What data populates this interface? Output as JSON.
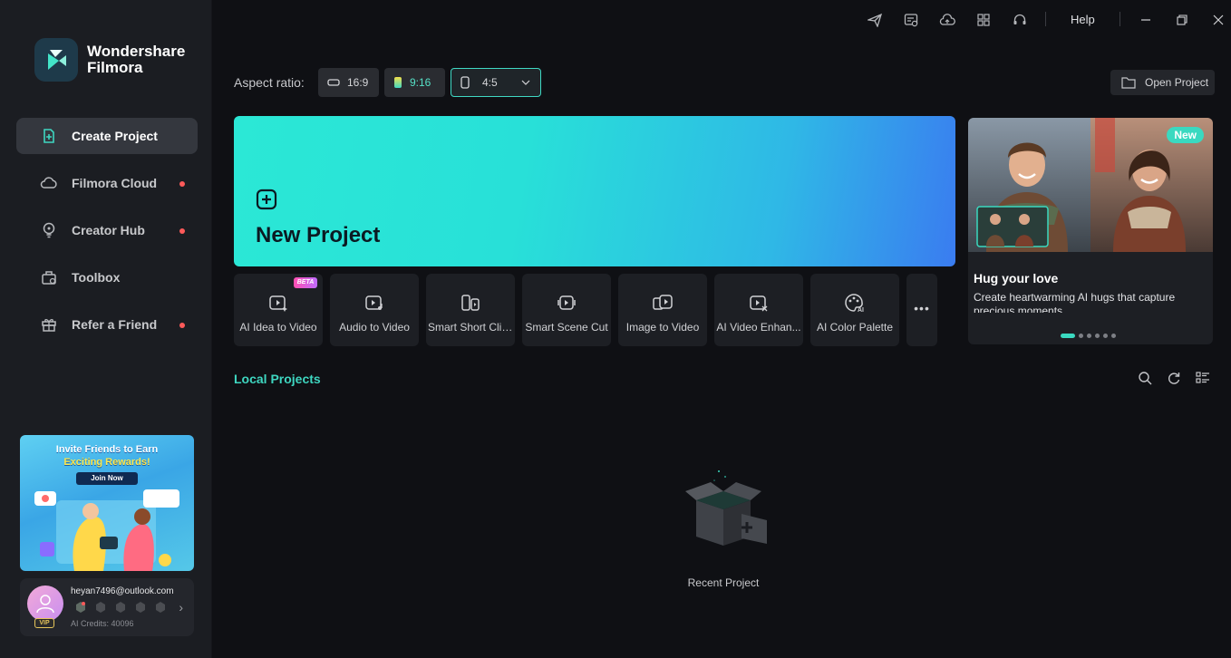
{
  "app": {
    "brand_line1": "Wondershare",
    "brand_line2": "Filmora"
  },
  "sidebar": {
    "items": [
      {
        "label": "Create Project",
        "icon": "create-project-icon",
        "active": true,
        "dot": false
      },
      {
        "label": "Filmora Cloud",
        "icon": "cloud-icon",
        "active": false,
        "dot": true
      },
      {
        "label": "Creator Hub",
        "icon": "lightbulb-icon",
        "active": false,
        "dot": true
      },
      {
        "label": "Toolbox",
        "icon": "toolbox-icon",
        "active": false,
        "dot": false
      },
      {
        "label": "Refer a Friend",
        "icon": "gift-icon",
        "active": false,
        "dot": true
      }
    ],
    "promo": {
      "title": "Invite Friends to Earn",
      "subtitle": "Exciting Rewards!",
      "button": "Join Now"
    },
    "account": {
      "email": "heyan7496@outlook.com",
      "vip": "VIP",
      "credits": "AI Credits: 40096"
    }
  },
  "topbar": {
    "help": "Help"
  },
  "aspect": {
    "label": "Aspect ratio:",
    "options": [
      "16:9",
      "9:16",
      "4:5"
    ],
    "selected": "4:5"
  },
  "open_project": "Open Project",
  "new_project": "New Project",
  "tools": [
    {
      "label": "AI Idea to Video",
      "badge": "BETA"
    },
    {
      "label": "Audio to Video"
    },
    {
      "label": "Smart Short Clips"
    },
    {
      "label": "Smart Scene Cut"
    },
    {
      "label": "Image to Video"
    },
    {
      "label": "AI Video Enhan..."
    },
    {
      "label": "AI Color Palette"
    }
  ],
  "banner": {
    "tag": "New",
    "title": "Hug your love",
    "description": "Create heartwarming AI hugs that capture precious moments."
  },
  "local_projects": {
    "title": "Local Projects",
    "empty_label": "Recent Project"
  },
  "colors": {
    "accent": "#3ed6c0",
    "background": "#0f1014",
    "sidebar": "#1b1d22",
    "notification_dot": "#ff5a5a"
  }
}
